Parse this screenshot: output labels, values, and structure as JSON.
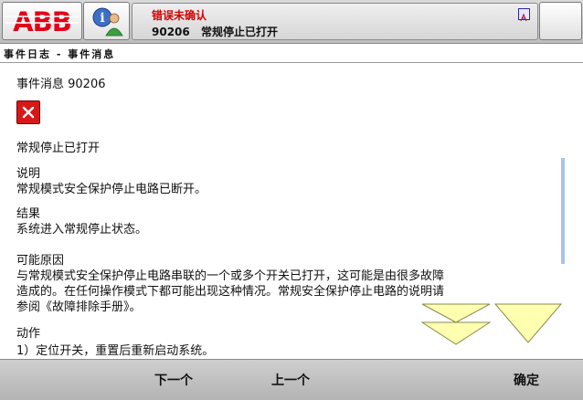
{
  "header": {
    "status_title": "错误未确认",
    "status_code": "90206",
    "status_message": "常规停止已打开",
    "brand": "ABB"
  },
  "view": {
    "title": "事件日志 - 事件消息"
  },
  "event": {
    "heading": "事件消息 90206",
    "title": "常规停止已打开",
    "description_label": "说明",
    "description_text": "常规模式安全保护停止电路已断开。",
    "consequences_label": "结果",
    "consequences_text": "系统进入常规停止状态。",
    "causes_label": "可能原因",
    "causes_lines": [
      "与常规模式安全保护停止电路串联的一个或多个开关已打开，这可能是由很多故障",
      "造成的。在任何操作模式下都可能出现这种情况。常规安全保护停止电路的说明请",
      "参阅《故障排除手册》。"
    ],
    "actions_label": "动作",
    "actions_text": "1）定位开关，重置后重新启动系统。"
  },
  "footer": {
    "next_label": "下一个",
    "prev_label": "上一个",
    "ok_label": "确定"
  },
  "icons": {
    "abb_logo": "abb-logo",
    "hotedit": "info-person-icon",
    "error": "error-x-icon",
    "scroll_up": "double-chevron-icon",
    "scroll_down": "chevron-down-icon"
  },
  "colors": {
    "brand_red": "#e2001a",
    "error_red": "#d81818",
    "status_red": "#d40000",
    "scroll_arrow": "#ffffb0"
  }
}
